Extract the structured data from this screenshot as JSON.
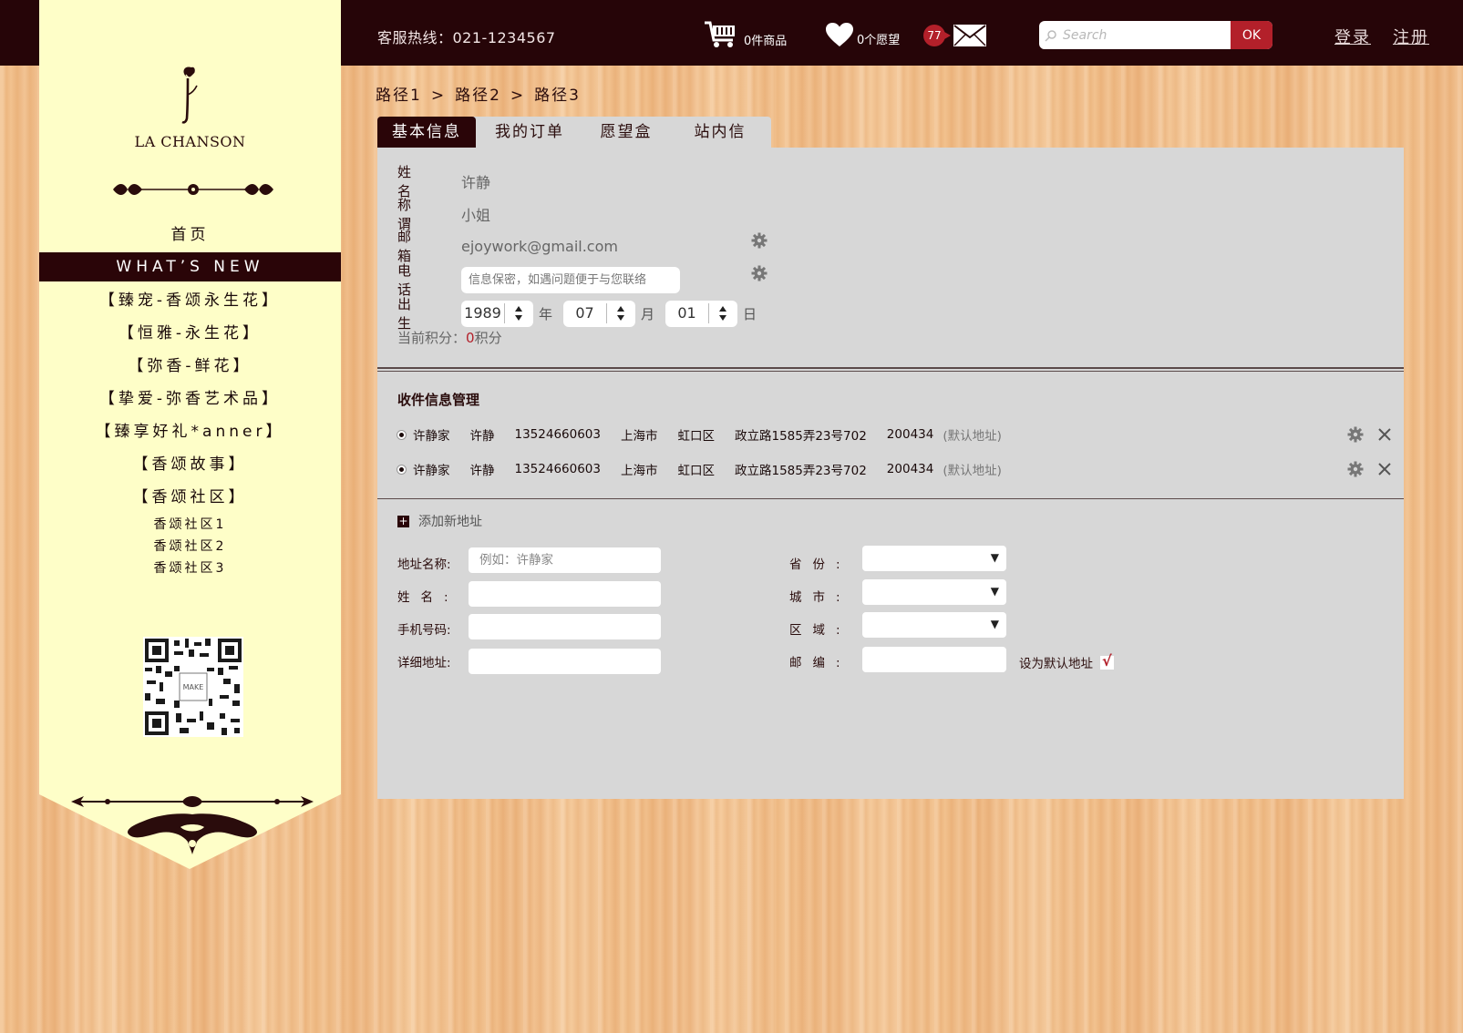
{
  "header": {
    "hotline": "客服热线：021-1234567",
    "cart_text": "0件商品",
    "wish_text": "0个愿望",
    "mail_count": "77",
    "search_placeholder": "Search",
    "search_button": "OK",
    "login": "登录",
    "register": "注册"
  },
  "sidebar": {
    "logo_text": "LA CHANSON",
    "nav": [
      {
        "label": "首页"
      },
      {
        "label": "WHAT’S NEW",
        "active": true
      },
      {
        "label": "【臻宠-香颂永生花】"
      },
      {
        "label": "【恒雅-永生花】"
      },
      {
        "label": "【弥香-鲜花】"
      },
      {
        "label": "【挚爱-弥香艺术品】"
      },
      {
        "label": "【臻享好礼*anner】"
      },
      {
        "label": "【香颂故事】"
      },
      {
        "label": "【香颂社区】"
      }
    ],
    "sub_nav": [
      "香颂社区1",
      "香颂社区2",
      "香颂社区3"
    ],
    "qr_label": "MAKE"
  },
  "breadcrumb": [
    "路径1",
    "路径2",
    "路径3"
  ],
  "breadcrumb_sep": ">",
  "tabs": [
    "基本信息",
    "我的订单",
    "愿望盒",
    "站内信"
  ],
  "profile": {
    "name_label": "姓名",
    "name_value": "许静",
    "title_label": "称谓",
    "title_value": "小姐",
    "email_label": "邮箱",
    "email_value": "ejoywork@gmail.com",
    "phone_label": "电话",
    "phone_placeholder": "信息保密，如遇问题便于与您联络",
    "birth_label": "出生",
    "year": "1989",
    "month": "07",
    "day": "01",
    "year_unit": "年",
    "month_unit": "月",
    "day_unit": "日",
    "points_label": "当前积分：",
    "points_value": "0",
    "points_unit": "积分"
  },
  "address_section": {
    "title": "收件信息管理",
    "addresses": [
      {
        "alias": "许静家",
        "name": "许静",
        "phone": "13524660603",
        "city": "上海市",
        "district": "虹口区",
        "street": "政立路1585弄23号702",
        "zip": "200434",
        "tag": "(默认地址)"
      },
      {
        "alias": "许静家",
        "name": "许静",
        "phone": "13524660603",
        "city": "上海市",
        "district": "虹口区",
        "street": "政立路1585弄23号702",
        "zip": "200434",
        "tag": "(默认地址)"
      }
    ],
    "add_new": "添加新地址"
  },
  "form": {
    "alias_label": "地址名称:",
    "alias_placeholder": "例如：许静家",
    "name_label": "姓名:",
    "mobile_label": "手机号码:",
    "detail_label": "详细地址:",
    "province_label": "省份:",
    "city_label": "城市:",
    "area_label": "区域:",
    "zip_label": "邮编:",
    "default_label": "设为默认地址",
    "default_checked": true
  },
  "colors": {
    "dark": "#260508",
    "accent": "#b3202a",
    "sidebar": "#fefec8",
    "panel": "#d7d7d7"
  }
}
